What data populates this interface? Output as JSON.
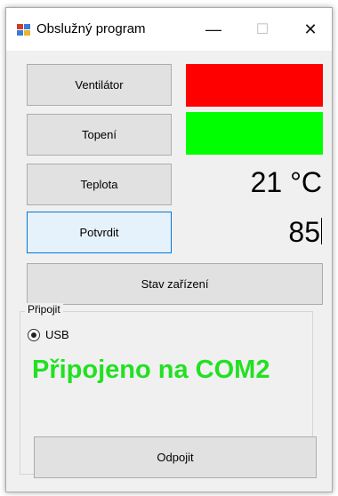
{
  "window": {
    "title": "Obslužný program",
    "minimize_glyph": "—",
    "maximize_glyph": "☐",
    "close_glyph": "✕"
  },
  "buttons": {
    "fan": "Ventilátor",
    "heating": "Topení",
    "temperature": "Teplota",
    "confirm": "Potvrdit",
    "device_status": "Stav zařízení",
    "disconnect": "Odpojit"
  },
  "indicators": {
    "fan_color": "#ff0000",
    "heating_color": "#00ff00"
  },
  "temperature_readout": "21 °C",
  "input_value": "85",
  "connection": {
    "group_label": "Připojit",
    "option_label": "USB",
    "option_selected": true,
    "status_text": "Připojeno na COM2",
    "status_color": "#22e022"
  }
}
